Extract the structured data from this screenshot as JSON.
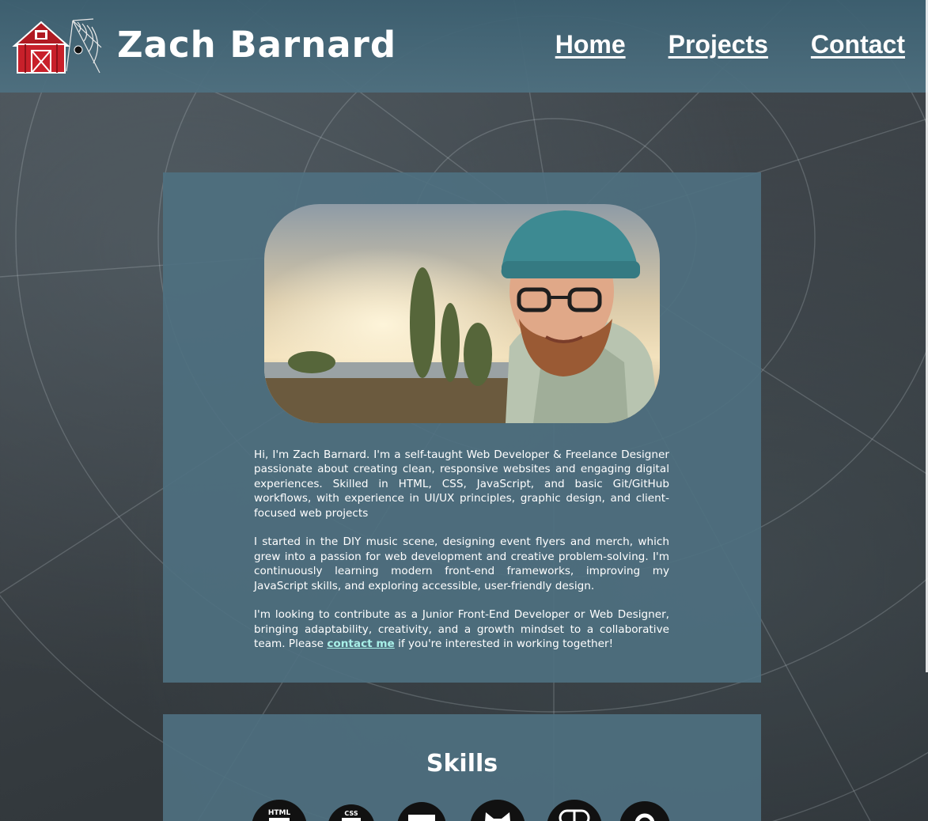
{
  "header": {
    "site_title": "Zach Barnard",
    "nav": {
      "home": "Home",
      "projects": "Projects",
      "contact": "Contact"
    }
  },
  "about": {
    "paragraph_1": "Hi, I'm Zach Barnard. I'm a self-taught Web Developer & Freelance Designer passionate about creating clean, responsive websites and engaging digital experiences. Skilled in HTML, CSS, JavaScript, and basic Git/GitHub workflows, with experience in UI/UX principles, graphic design, and client-focused web projects",
    "paragraph_2": "I started in the DIY music scene, designing event flyers and merch, which grew into a passion for web development and creative problem-solving. I'm continuously learning modern front-end frameworks, improving my JavaScript skills, and exploring accessible, user-friendly design.",
    "paragraph_3_before": "I'm looking to contribute as a Junior Front-End Developer or Web Designer, bringing adaptability, creativity, and a growth mindset to a collaborative team. Please ",
    "contact_link": "contact me",
    "paragraph_3_after": " if you're interested in working together!"
  },
  "skills": {
    "title": "Skills",
    "icons": [
      {
        "name": "html-icon",
        "label": "HTML"
      },
      {
        "name": "css-icon",
        "label": "CSS"
      },
      {
        "name": "javascript-icon"
      },
      {
        "name": "github-icon"
      },
      {
        "name": "figma-icon"
      },
      {
        "name": "location-icon"
      }
    ]
  },
  "colors": {
    "header_bg": "#4e7080",
    "card_bg": "#4e7080",
    "link_accent": "#a8f0e8",
    "barn_red": "#c8202a"
  }
}
